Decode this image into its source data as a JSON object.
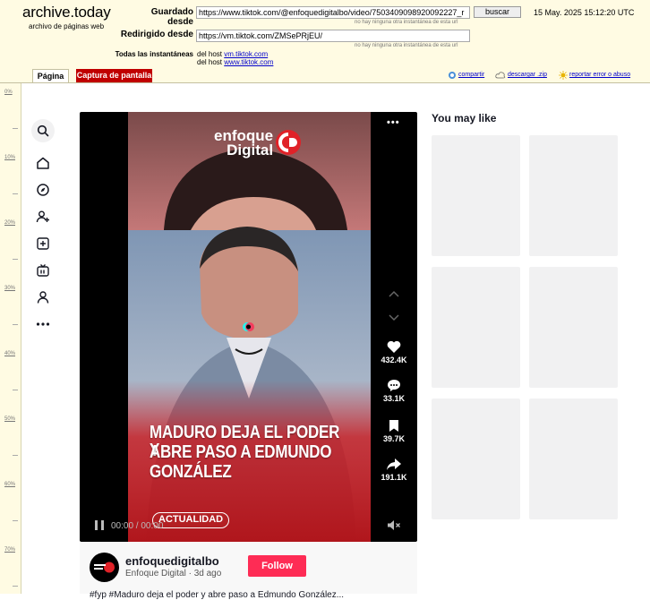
{
  "archive": {
    "logo": "archive.today",
    "subtitle": "archivo de páginas web",
    "saved_from_label": "Guardado desde",
    "saved_from_url": "https://www.tiktok.com/@enfoquedigitalbo/video/7503409098920092227_r",
    "no_other_snapshot": "no hay ninguna otra instantánea de esta url",
    "search_button": "buscar",
    "timestamp": "15 May. 2025 15:12:20 UTC",
    "redirected_label": "Redirigido desde",
    "redirected_url": "https://vm.tiktok.com/ZMSePRjEU/",
    "all_snapshots_label": "Todas las instantáneas",
    "host_prefix": "del host",
    "host1": "vm.tiktok.com",
    "host2": "www.tiktok.com",
    "tabs": {
      "page": "Página",
      "screenshot": "Captura de pantalla"
    },
    "links": {
      "share": "compartir",
      "download": "descargar .zip",
      "report": "reportar error o abuso"
    }
  },
  "ruler": [
    "0%",
    "10%",
    "20%",
    "30%",
    "40%",
    "50%",
    "60%",
    "70%"
  ],
  "sidebar": {
    "icons": [
      "search-icon",
      "home-icon",
      "explore-icon",
      "following-icon",
      "upload-icon",
      "live-icon",
      "profile-icon",
      "more-icon"
    ]
  },
  "video": {
    "brand_line1": "enfoque",
    "brand_line2": "Digital",
    "badge": "ACTUALIDAD",
    "caption_line1": "MADURO DEJA EL PODER Y",
    "caption_line2": "ABRE PASO A EDMUNDO",
    "caption_line3": "GONZÁLEZ",
    "likes": "432.4K",
    "comments": "33.1K",
    "saves": "39.7K",
    "shares": "191.1K",
    "time": "00:00 / 00:00",
    "menu": "•••"
  },
  "author": {
    "username": "enfoquedigitalbo",
    "meta": "Enfoque Digital · 3d ago",
    "follow": "Follow",
    "description_start": "#fyp #Maduro deja el poder y abre paso a Edmundo González..."
  },
  "recommend": {
    "title": "You may like"
  },
  "colors": {
    "header_bg": "#fffbe3",
    "tiktok_red": "#fe2c55",
    "screenshot_tab": "#c00000",
    "video_red": "#c62026"
  }
}
